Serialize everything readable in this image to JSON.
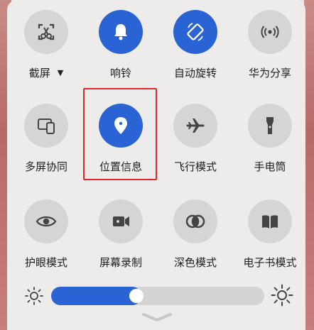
{
  "quick_settings": {
    "row1": [
      {
        "label": "截屏",
        "icon": "screenshot-scissors-icon",
        "active": false,
        "has_dropdown": true,
        "dropdown_glyph": "▼"
      },
      {
        "label": "响铃",
        "icon": "bell-icon",
        "active": true
      },
      {
        "label": "自动旋转",
        "icon": "auto-rotate-icon",
        "active": true
      },
      {
        "label": "华为分享",
        "icon": "huawei-share-icon",
        "active": false
      }
    ],
    "row2": [
      {
        "label": "多屏协同",
        "icon": "multi-screen-icon",
        "active": false
      },
      {
        "label": "位置信息",
        "icon": "location-pin-icon",
        "active": true
      },
      {
        "label": "飞行模式",
        "icon": "airplane-icon",
        "active": false
      },
      {
        "label": "手电筒",
        "icon": "flashlight-icon",
        "active": false
      }
    ],
    "row3": [
      {
        "label": "护眼模式",
        "icon": "eye-icon",
        "active": false
      },
      {
        "label": "屏幕录制",
        "icon": "screen-record-icon",
        "active": false
      },
      {
        "label": "深色模式",
        "icon": "dark-mode-icon",
        "active": false
      },
      {
        "label": "电子书模式",
        "icon": "ebook-icon",
        "active": false
      }
    ]
  },
  "brightness": {
    "level_fraction": 0.39,
    "low_icon": "sun-small-icon",
    "high_icon": "sun-large-icon"
  },
  "colors": {
    "accent": "#2a63d3",
    "inactive": "#d7d4d4",
    "highlight_box": "#e3262a",
    "text": "#1f1f1f"
  },
  "bottom": {
    "icon": "chevron-down-icon"
  }
}
